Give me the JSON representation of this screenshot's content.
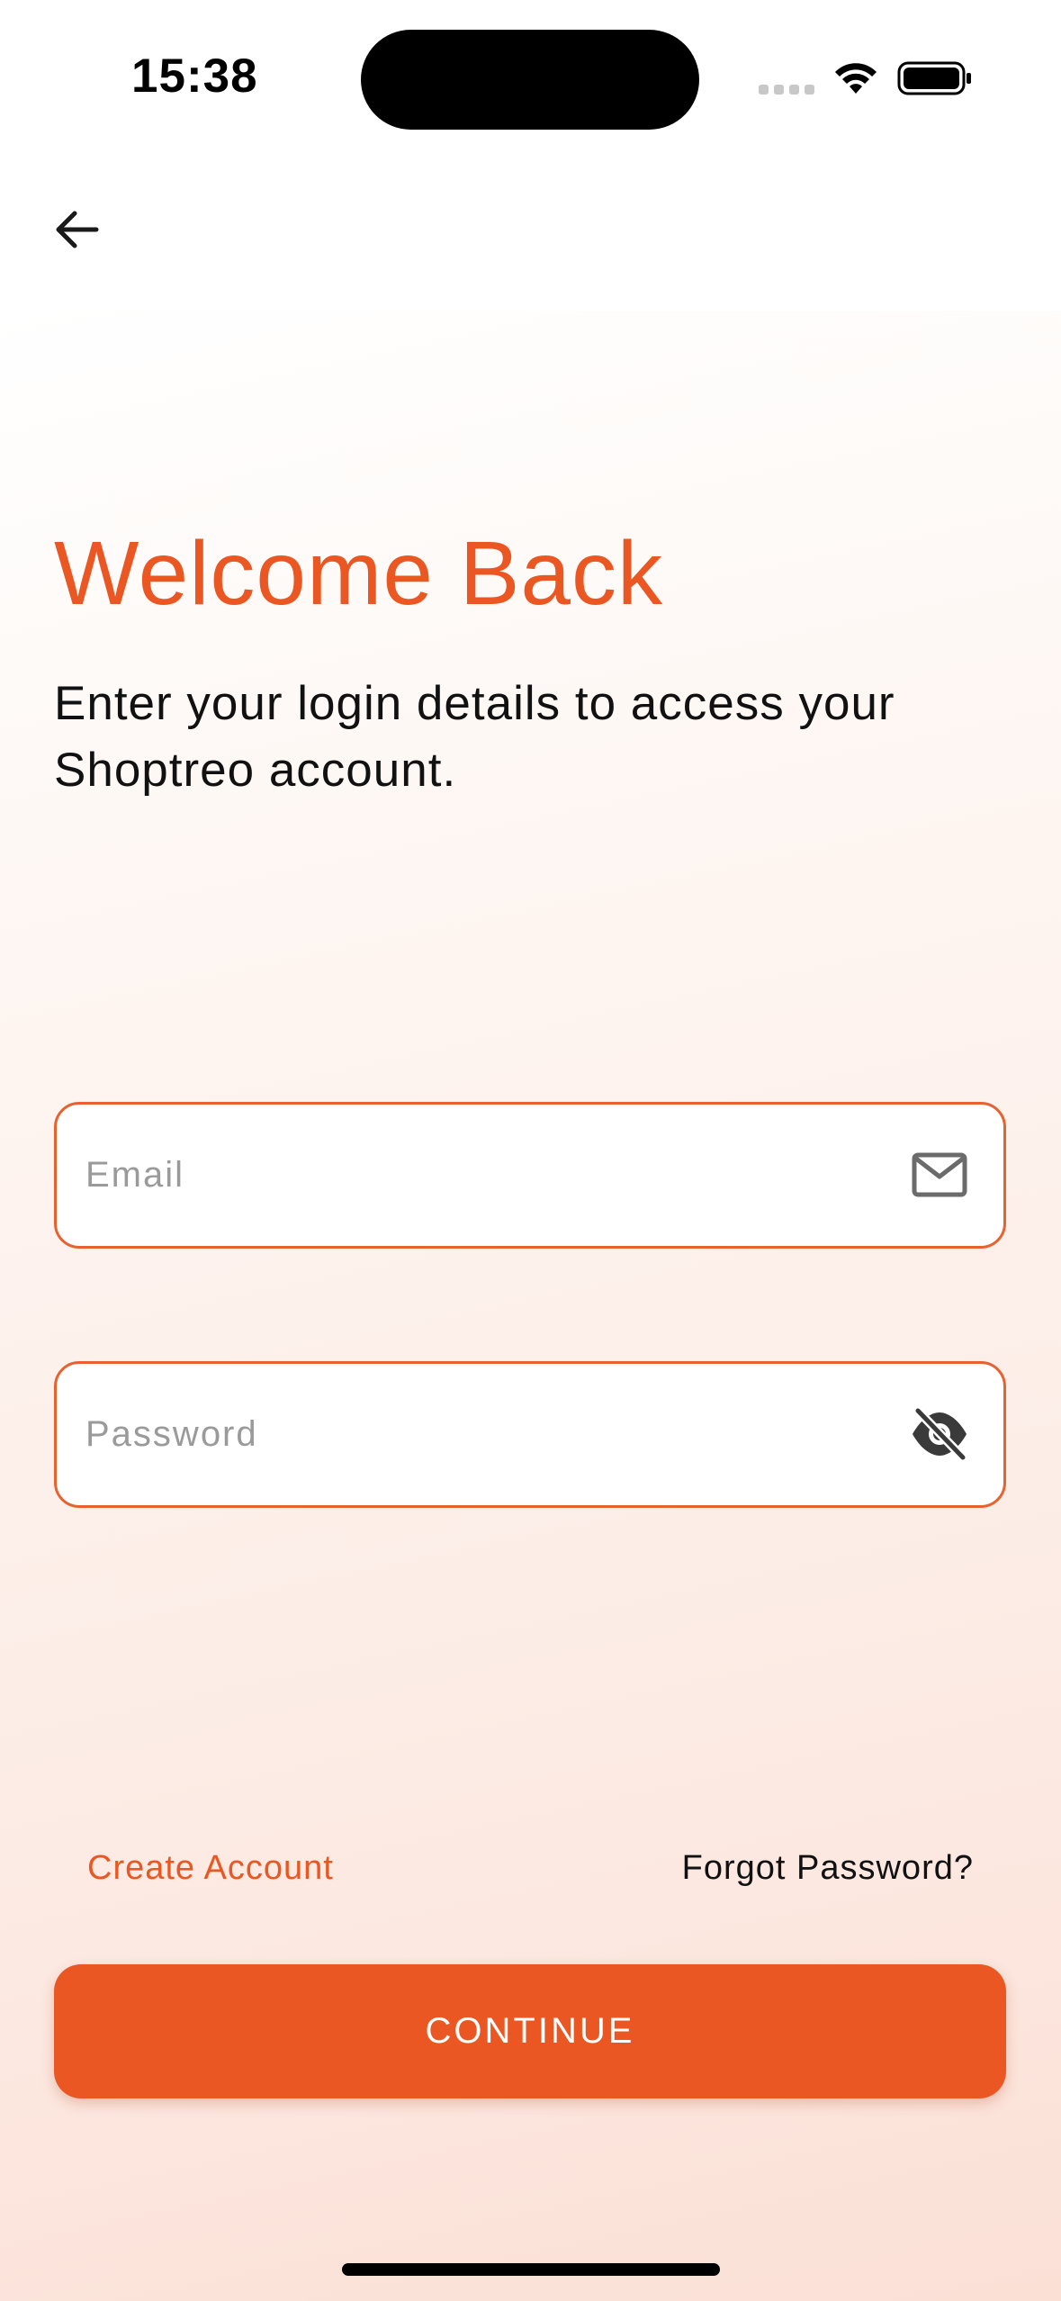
{
  "status_bar": {
    "time": "15:38"
  },
  "header": {
    "back_icon": "arrow-left-icon"
  },
  "main": {
    "title": "Welcome Back",
    "subtitle": "Enter your login details to access your Shoptreo account.",
    "email": {
      "placeholder": "Email",
      "value": "",
      "icon": "mail-icon"
    },
    "password": {
      "placeholder": "Password",
      "value": "",
      "icon": "eye-off-icon"
    },
    "create_account_label": "Create Account",
    "forgot_password_label": "Forgot Password?",
    "continue_label": "CONTINUE"
  },
  "colors": {
    "accent": "#ea5722",
    "text": "#111111",
    "placeholder": "#9a9a9a"
  }
}
